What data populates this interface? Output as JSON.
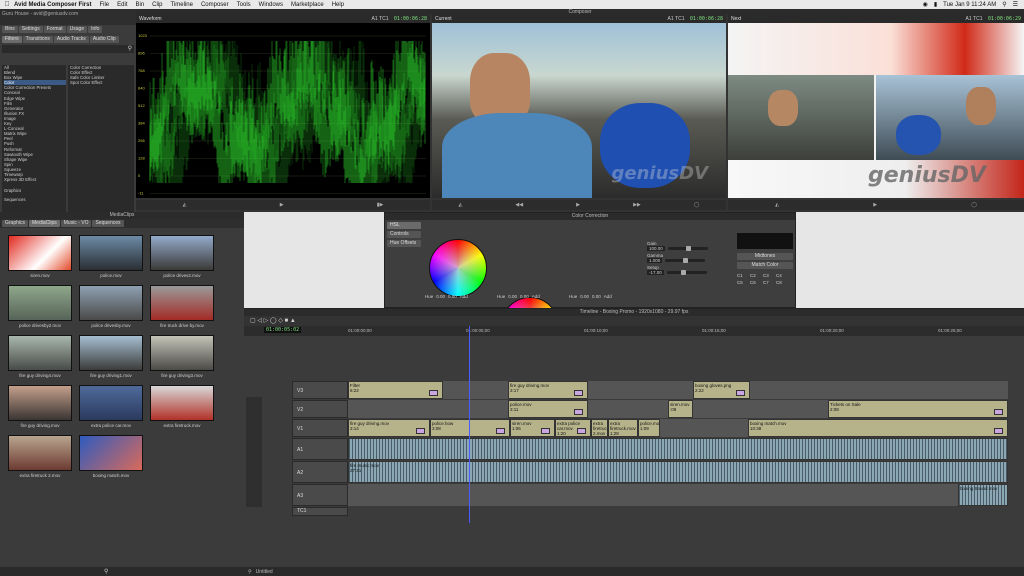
{
  "menubar": {
    "app": "Avid Media Composer First",
    "items": [
      "File",
      "Edit",
      "Bin",
      "Clip",
      "Timeline",
      "Composer",
      "Tools",
      "Windows",
      "Marketplace",
      "Help"
    ],
    "datetime": "Tue Jan 9  11:24 AM"
  },
  "effect_palette": {
    "user": "Guru House - avid@geniusdv.com",
    "top_tabs": [
      "Bins",
      "Settings",
      "Format",
      "Usage",
      "Info"
    ],
    "tabs": [
      "Filters",
      "Transitions",
      "Audio Tracks",
      "Audio Clip"
    ],
    "categories": [
      "All",
      "Blend",
      "Box Wipe",
      "Color",
      "Color Correction Presets",
      "Conceal",
      "Edge Wipe",
      "Film",
      "Generator",
      "Illusion FX",
      "Image",
      "Key",
      "L-Conceal",
      "Matrix Wipe",
      "Peel",
      "Push",
      "Reformat",
      "Sawtooth Wipe",
      "Shape Wipe",
      "Spin",
      "Squeeze",
      "Timewarp",
      "Xpress 3D Effect",
      "Graphics",
      "Sequences"
    ],
    "selected_category": "Color",
    "effects": [
      "Color Correction",
      "Color Effect",
      "Safe Color Limiter",
      "Spot Color Effect"
    ]
  },
  "composer": {
    "title": "Composer",
    "monitors": [
      {
        "label": "Waveform",
        "track": "A1",
        "tcmode": "TC1",
        "tc": "01:00:06:28"
      },
      {
        "label": "Current",
        "track": "A1",
        "tcmode": "TC1",
        "tc": "01:00:06:28"
      },
      {
        "label": "Next",
        "track": "A1",
        "tcmode": "TC1",
        "tc": "01:00:06:29"
      }
    ],
    "waveform_scale": [
      "1023",
      "896",
      "768",
      "640",
      "512",
      "384",
      "256",
      "128",
      "0",
      "-11"
    ],
    "watermark": "geniusDV"
  },
  "media": {
    "title": "MediaClips",
    "tabs": [
      "Graphics",
      "MediaClips",
      "Music - VO",
      "Sequences"
    ],
    "clips": [
      "siren.mov",
      "police.mov",
      "police drives2.mov",
      "police drivesby2.mov",
      "police drivesby.mov",
      "fire truck drive by.mov",
      "fire guy driving4.mov",
      "fire guy driving1.mov",
      "fire guy driving3.mov",
      "fire guy driving.mov",
      "extra police car.mov",
      "extra firetruck.mov",
      "extra firetruck 2.mov",
      "boxing match.mov"
    ]
  },
  "color_correction": {
    "title": "Color Correction",
    "tab": "HSL",
    "side": [
      "Controls",
      "Hue Offsets"
    ],
    "wheel_fields": [
      [
        "Hue",
        "0.00",
        "0.00",
        "Add"
      ],
      [
        "Hue",
        "0.00",
        "0.00",
        "Add"
      ],
      [
        "Hue",
        "0.00",
        "0.00",
        "Add"
      ]
    ],
    "params": [
      {
        "name": "Gain",
        "value": "100.00"
      },
      {
        "name": "Gamma",
        "value": "1.000"
      },
      {
        "name": "Setup",
        "value": "-17.00"
      }
    ],
    "match_labels": [
      "Midtones",
      "Match Color"
    ],
    "buckets": [
      "C1",
      "C2",
      "C3",
      "C4",
      "C5",
      "C6",
      "C7",
      "C8"
    ]
  },
  "timeline": {
    "title": "Timeline - Boxing Promo - 1920x1080 - 29.97 fps",
    "tc": "01:00:05:02",
    "ruler": [
      "01:00:00;00",
      "01:00:05;00",
      "01:00:10;00",
      "01:00:15;00",
      "01:00:20;00",
      "01:00:25;00"
    ],
    "tracks": [
      "V3",
      "V2",
      "V1",
      "A1",
      "A2",
      "A3",
      "TC1"
    ],
    "v3": [
      {
        "name": "Filter",
        "dur": "6:22"
      },
      {
        "name": "fire guy driving.mov",
        "dur": "3:17"
      },
      {
        "name": "boxing gloves.png",
        "dur": "2:22"
      }
    ],
    "v2": [
      {
        "name": "police.mov",
        "dur": "3:11"
      },
      {
        "name": "siren.mov",
        "dur": ":08"
      },
      {
        "name": "Tickets on Sale",
        "dur": "2:08"
      },
      {
        "name": "15th Fight Night",
        "dur": "10:38"
      }
    ],
    "v1": [
      {
        "name": "fire guy driving.mov",
        "dur": "3:14"
      },
      {
        "name": "police.how",
        "dur": "3:08"
      },
      {
        "name": "siren.mov",
        "dur": "1:06"
      },
      {
        "name": "extra police car.mov",
        "dur": "1:20"
      },
      {
        "name": "extra firetruck 2.mov",
        "dur": "1:22"
      },
      {
        "name": "extra firetruck.mov",
        "dur": "1:28"
      },
      {
        "name": "police.mov",
        "dur": "1:09"
      },
      {
        "name": "boxing match.mov",
        "dur": "10:38"
      }
    ],
    "a2": [
      {
        "name": "fire music.mov",
        "dur": "27:21"
      }
    ],
    "a3": [
      {
        "name": "boxing Sound.mov"
      }
    ],
    "bottom": "Untitled"
  },
  "colors": {
    "video_clip": "#b6b38a",
    "audio_clip": "#8aa7b3",
    "timecode": "#7fe07f",
    "waveform": "#2fdc2f"
  }
}
